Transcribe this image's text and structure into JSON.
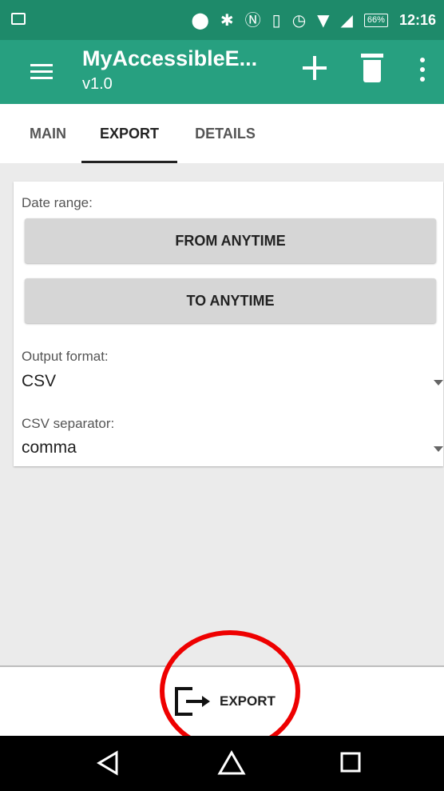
{
  "status_bar": {
    "battery": "66%",
    "time": "12:16",
    "icons": [
      "image-icon",
      "location-icon",
      "bluetooth-icon",
      "nfc-icon",
      "vibrate-icon",
      "alarm-icon",
      "wifi-icon",
      "signal-icon",
      "battery-icon"
    ]
  },
  "app_bar": {
    "title": "MyAccessibleE...",
    "subtitle": "v1.0",
    "actions": [
      "menu-icon",
      "plus-icon",
      "trash-icon",
      "overflow-icon"
    ]
  },
  "tabs": [
    {
      "label": "MAIN",
      "active": false
    },
    {
      "label": "EXPORT",
      "active": true
    },
    {
      "label": "DETAILS",
      "active": false
    }
  ],
  "form": {
    "date_range_label": "Date range:",
    "from_button": "FROM ANYTIME",
    "to_button": "TO ANYTIME",
    "output_format_label": "Output format:",
    "output_format_value": "CSV",
    "separator_label": "CSV separator:",
    "separator_value": "comma"
  },
  "bottom_action": {
    "label": "EXPORT",
    "highlight_color": "#ee0000"
  },
  "colors": {
    "status_bar": "#1e8a6a",
    "app_bar": "#27a080"
  }
}
